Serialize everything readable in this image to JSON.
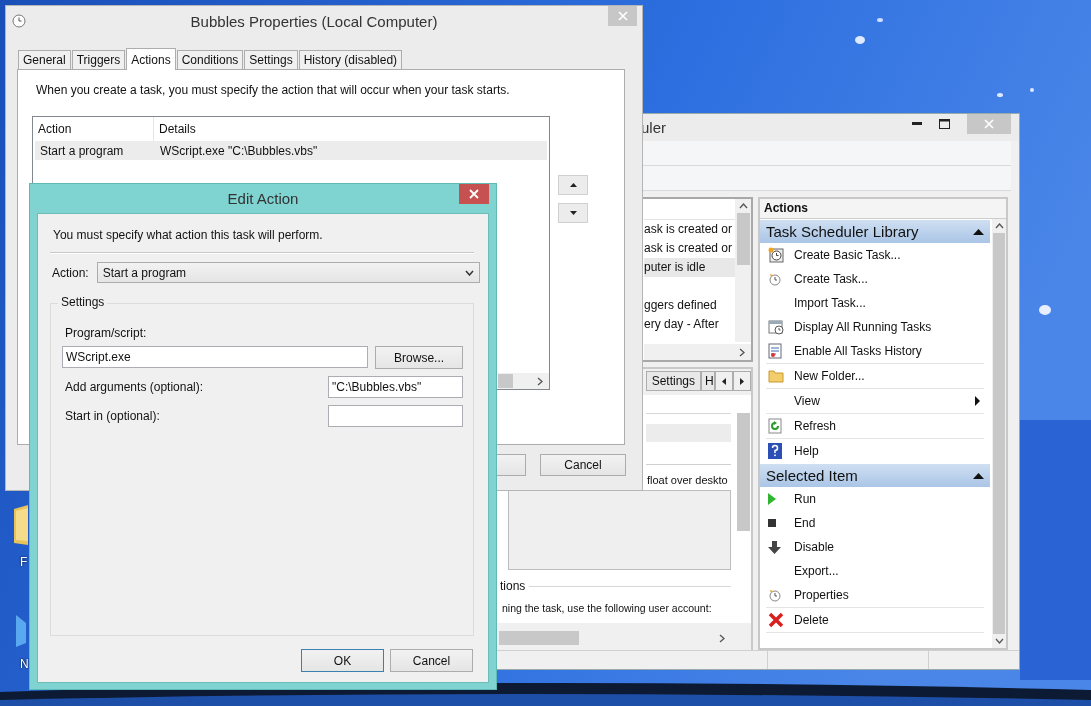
{
  "desktop": {
    "icons": [
      {
        "label": "F",
        "kind": "folder"
      },
      {
        "label": "N",
        "kind": "arrow"
      }
    ]
  },
  "task_scheduler": {
    "title": "uler",
    "task_list": {
      "groups": [
        [
          {
            "text": "ask is created or",
            "selected": false
          },
          {
            "text": "ask is created or",
            "selected": false
          },
          {
            "text": "puter is idle",
            "selected": true
          }
        ],
        [
          {
            "text": "ggers defined",
            "selected": false
          },
          {
            "text": "ery day - After",
            "selected": false
          }
        ]
      ]
    },
    "detail_tabs": [
      {
        "label": "Settings",
        "selected": false
      },
      {
        "label": "H",
        "selected": false
      }
    ],
    "detail": {
      "description": "float over deskto",
      "section_title": "tions",
      "account_text": "ning the task, use the following user account:"
    },
    "actions_pane": {
      "title": "Actions",
      "sections": [
        {
          "title": "Task Scheduler Library",
          "expanded": true,
          "items": [
            {
              "label": "Create Basic Task...",
              "kind": "basic",
              "divider": false,
              "submenu": false
            },
            {
              "label": "Create Task...",
              "kind": "create",
              "divider": false,
              "submenu": false
            },
            {
              "label": "Import Task...",
              "kind": "import",
              "divider": false,
              "submenu": false
            },
            {
              "label": "Display All Running Tasks",
              "kind": "running",
              "divider": false,
              "submenu": false
            },
            {
              "label": "Enable All Tasks History",
              "kind": "history",
              "divider": true,
              "submenu": false
            },
            {
              "label": "New Folder...",
              "kind": "folder",
              "divider": true,
              "submenu": false
            },
            {
              "label": "View",
              "kind": "view",
              "divider": true,
              "submenu": true
            },
            {
              "label": "Refresh",
              "kind": "refresh",
              "divider": true,
              "submenu": false
            },
            {
              "label": "Help",
              "kind": "help",
              "divider": false,
              "submenu": false
            }
          ]
        },
        {
          "title": "Selected Item",
          "expanded": true,
          "items": [
            {
              "label": "Run",
              "kind": "run",
              "divider": false,
              "submenu": false
            },
            {
              "label": "End",
              "kind": "end",
              "divider": false,
              "submenu": false
            },
            {
              "label": "Disable",
              "kind": "disable",
              "divider": false,
              "submenu": false
            },
            {
              "label": "Export...",
              "kind": "export",
              "divider": false,
              "submenu": false
            },
            {
              "label": "Properties",
              "kind": "properties",
              "divider": true,
              "submenu": false
            },
            {
              "label": "Delete",
              "kind": "delete",
              "divider": true,
              "submenu": false
            }
          ]
        }
      ]
    }
  },
  "properties": {
    "title": "Bubbles Properties (Local Computer)",
    "tabs": [
      {
        "label": "General",
        "selected": false
      },
      {
        "label": "Triggers",
        "selected": false
      },
      {
        "label": "Actions",
        "selected": true
      },
      {
        "label": "Conditions",
        "selected": false
      },
      {
        "label": "Settings",
        "selected": false
      },
      {
        "label": "History (disabled)",
        "selected": false
      }
    ],
    "description": "When you create a task, you must specify the action that will occur when your task starts.",
    "actions_table": {
      "columns": [
        "Action",
        "Details"
      ],
      "rows": [
        {
          "action": "Start a program",
          "details": "WScript.exe \"C:\\Bubbles.vbs\"",
          "selected": true
        }
      ]
    },
    "buttons": [
      "Cancel"
    ]
  },
  "edit_action": {
    "title": "Edit Action",
    "instruction": "You must specify what action this task will perform.",
    "action": {
      "label": "Action:",
      "value": "Start a program"
    },
    "settings": {
      "title": "Settings",
      "program": {
        "label": "Program/script:",
        "value": "WScript.exe"
      },
      "browse": "Browse...",
      "arguments": {
        "label": "Add arguments (optional):",
        "value": "\"C:\\Bubbles.vbs\""
      },
      "start_in": {
        "label": "Start in (optional):"
      }
    },
    "buttons": [
      {
        "label": "OK",
        "default": true
      },
      {
        "label": "Cancel",
        "default": false
      }
    ]
  }
}
